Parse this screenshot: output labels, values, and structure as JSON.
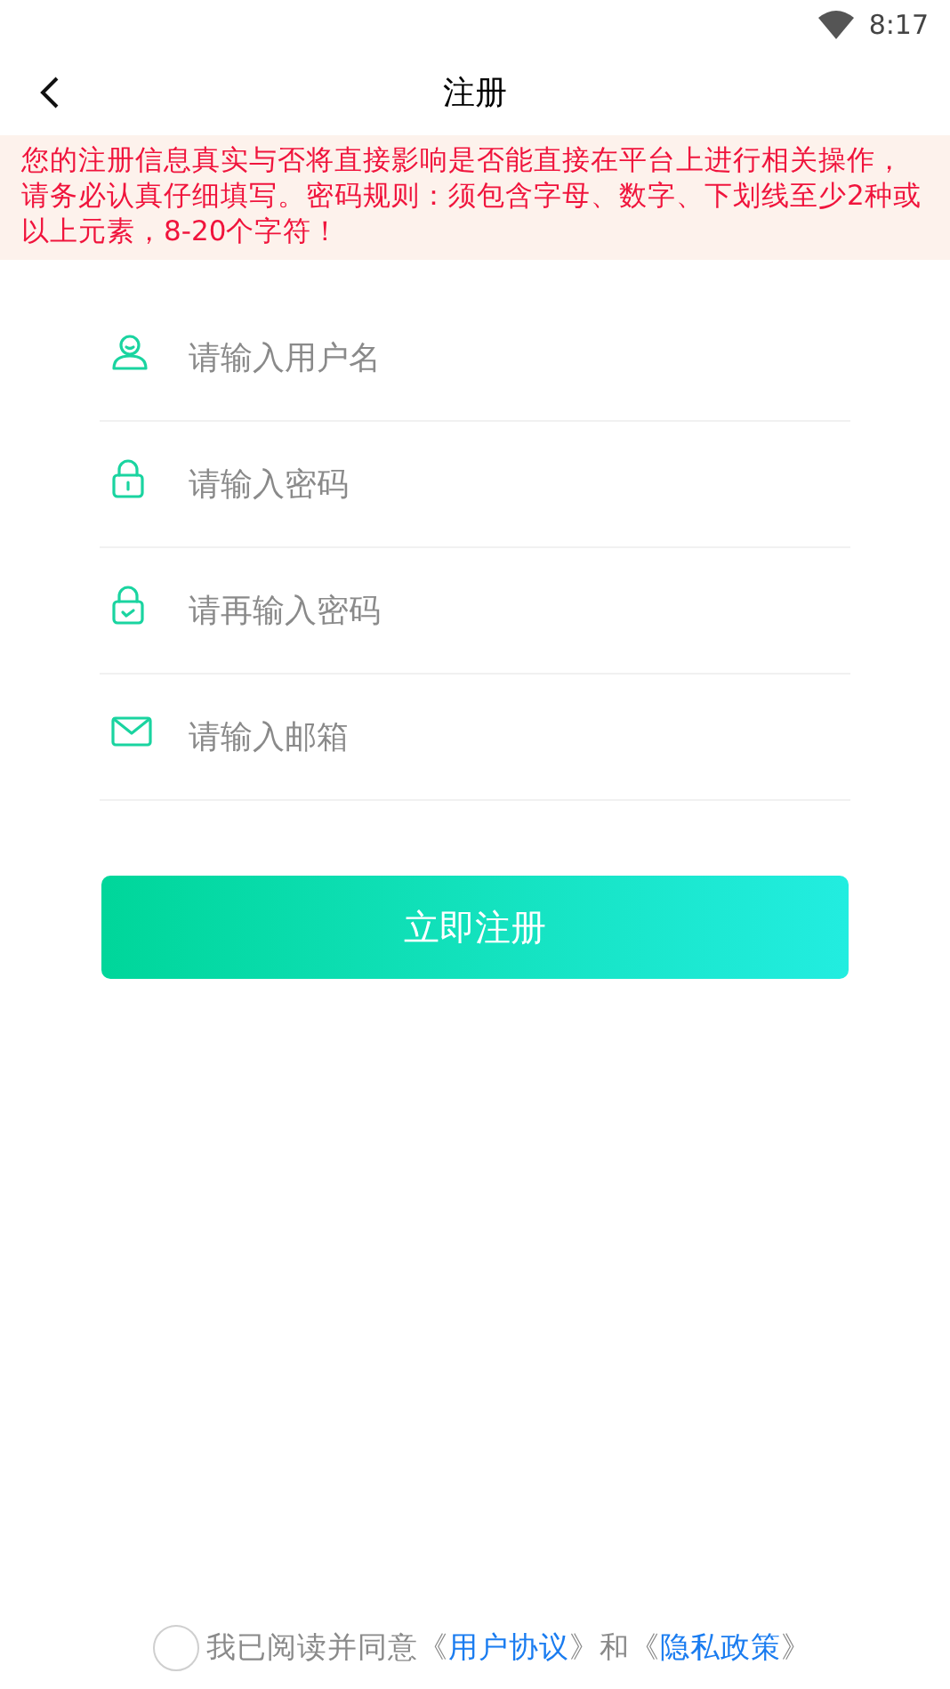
{
  "status_bar": {
    "time": "8:17"
  },
  "header": {
    "title": "注册"
  },
  "notice": "您的注册信息真实与否将直接影响是否能直接在平台上进行相关操作，请务必认真仔细填写。密码规则：须包含字母、数字、下划线至少2种或以上元素，8-20个字符！",
  "fields": [
    {
      "kind": "user",
      "placeholder": "请输入用户名"
    },
    {
      "kind": "password",
      "placeholder": "请输入密码"
    },
    {
      "kind": "confirm",
      "placeholder": "请再输入密码"
    },
    {
      "kind": "email",
      "placeholder": "请输入邮箱"
    }
  ],
  "submit": "立即注册",
  "agreement": {
    "checked": false,
    "parts": [
      {
        "kind": "text",
        "text": "我已阅读并同意《"
      },
      {
        "kind": "link",
        "text": "用户协议"
      },
      {
        "kind": "text",
        "text": "》和《"
      },
      {
        "kind": "link",
        "text": "隐私政策"
      },
      {
        "kind": "text",
        "text": "》"
      }
    ]
  }
}
